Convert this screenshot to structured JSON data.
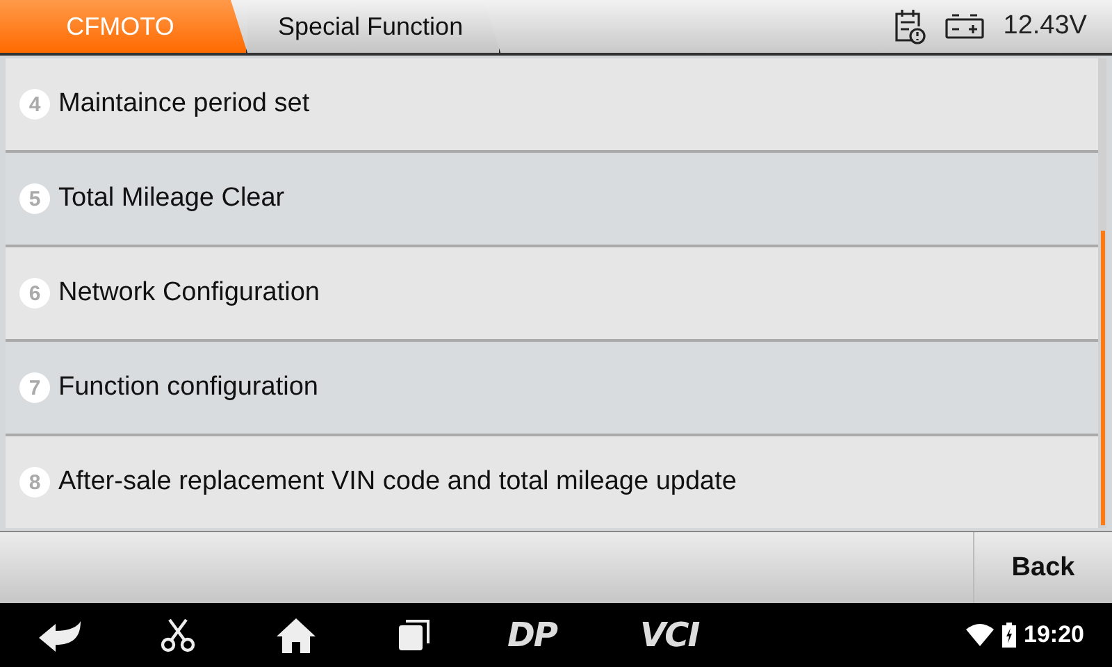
{
  "breadcrumbs": [
    {
      "label": "CFMOTO",
      "selected": true
    },
    {
      "label": "Special Function",
      "selected": false
    }
  ],
  "status": {
    "voltage": "12.43V"
  },
  "items": [
    {
      "number": "4",
      "label": "Maintaince period set"
    },
    {
      "number": "5",
      "label": "Total Mileage Clear"
    },
    {
      "number": "6",
      "label": "Network Configuration"
    },
    {
      "number": "7",
      "label": "Function configuration"
    },
    {
      "number": "8",
      "label": "After-sale replacement VIN code and total mileage update"
    }
  ],
  "footer": {
    "button": "Back"
  },
  "navbar": {
    "dp": "DP",
    "vci": "VCI",
    "time": "19:20"
  }
}
